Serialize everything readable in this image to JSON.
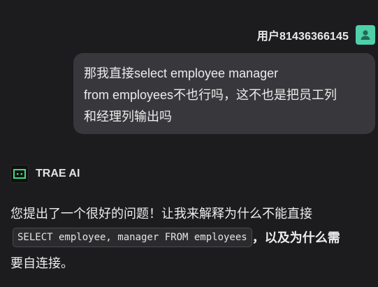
{
  "user": {
    "name": "用户81436366145",
    "avatar_icon": "user-avatar-icon",
    "avatar_color": "#4fd0a8"
  },
  "user_message": {
    "lines": [
      "那我直接select employee manager",
      "from employees不也行吗，这不也是把员工列",
      "和经理列输出吗"
    ]
  },
  "assistant": {
    "name": "TRAE AI",
    "logo_icon": "trae-logo-icon",
    "logo_color": "#3ddc84"
  },
  "assistant_message": {
    "line1": "您提出了一个很好的问题！让我来解释为什么不能直接",
    "code": "SELECT employee, manager FROM employees",
    "line2_after": "，以及为什么需",
    "line3": "要自连接。"
  }
}
